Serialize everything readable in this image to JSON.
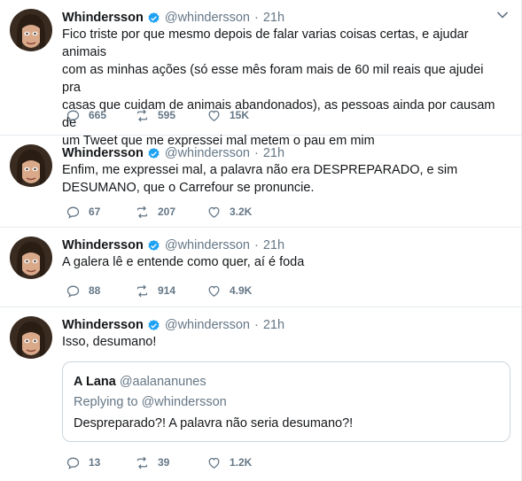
{
  "colors": {
    "verified_blue": "#1da1f2",
    "secondary_text": "#657786",
    "divider": "#e6ecf0"
  },
  "tweets": [
    {
      "name": "Whindersson",
      "handle": "@whindersson",
      "dot": "·",
      "time": "21h",
      "text": "Fico triste por que mesmo depois de falar varias coisas certas, e ajudar animais\ncom as minhas ações (só esse mês foram mais de 60 mil reais que ajudei pra\ncasas que cuidam de animais abandonados), as pessoas ainda por causam de\num Tweet que me expressei mal metem o pau em mim",
      "replies": "665",
      "retweets": "595",
      "likes": "15K"
    },
    {
      "name": "Whindersson",
      "handle": "@whindersson",
      "dot": "·",
      "time": "21h",
      "text": "Enfim, me expressei mal, a palavra não era DESPREPARADO, e sim\nDESUMANO, que o Carrefour se pronuncie.",
      "replies": "67",
      "retweets": "207",
      "likes": "3.2K"
    },
    {
      "name": "Whindersson",
      "handle": "@whindersson",
      "dot": "·",
      "time": "21h",
      "text": "A galera lê e entende como quer, aí é foda",
      "replies": "88",
      "retweets": "914",
      "likes": "4.9K"
    },
    {
      "name": "Whindersson",
      "handle": "@whindersson",
      "dot": "·",
      "time": "21h",
      "text": "Isso, desumano!",
      "replies": "13",
      "retweets": "39",
      "likes": "1.2K",
      "quote": {
        "name": "A Lana",
        "handle": "@aalananunes",
        "replying_prefix": "Replying to",
        "replying_handle": "@whindersson",
        "text": "Despreparado?! A palavra não seria desumano?!"
      }
    }
  ]
}
